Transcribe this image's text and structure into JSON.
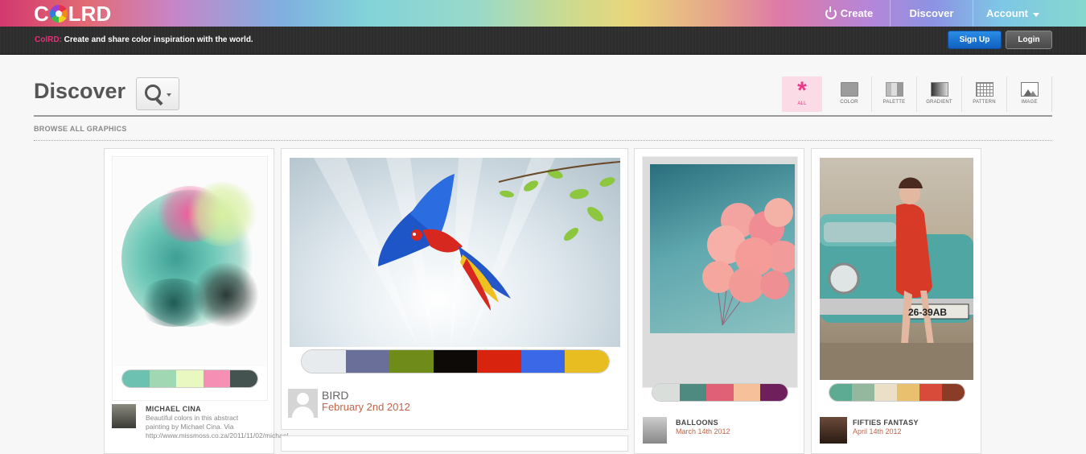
{
  "header": {
    "logo_left": "C",
    "logo_right": "LRD",
    "nav": {
      "create": "Create",
      "discover": "Discover",
      "account": "Account"
    }
  },
  "subbar": {
    "brand": "ColRD:",
    "tagline": " Create and share color inspiration with the world.",
    "signup": "Sign Up",
    "login": "Login"
  },
  "page": {
    "title": "Discover",
    "browse_label": "BROWSE ALL GRAPHICS"
  },
  "filters": [
    {
      "label": "ALL",
      "icon": "star-icon",
      "active": true
    },
    {
      "label": "COLOR",
      "icon": "color-icon"
    },
    {
      "label": "PALETTE",
      "icon": "palette-icon"
    },
    {
      "label": "GRADIENT",
      "icon": "gradient-icon"
    },
    {
      "label": "PATTERN",
      "icon": "pattern-icon"
    },
    {
      "label": "IMAGE",
      "icon": "image-icon"
    }
  ],
  "cards": [
    {
      "author": "MICHAEL CINA",
      "desc_line1": "Beautiful colors in this abstract",
      "desc_line2": "painting by Michael Cina. Via",
      "desc_line3": "http://www.missmoss.co.za/2011/11/02/michael",
      "swatches": [
        "#6cc1b0",
        "#9fd8b2",
        "#e9f7c0",
        "#f58fb3",
        "#445350"
      ]
    },
    {
      "title": "BIRD",
      "date": "February 2nd 2012",
      "swatches": [
        "#e8ebee",
        "#6a6f9a",
        "#6f8c1a",
        "#0d0a08",
        "#d8230f",
        "#3a68e6",
        "#e8bd22"
      ]
    },
    {
      "author": "BALLOONS",
      "date": "March 14th 2012",
      "swatches": [
        "#d9dedb",
        "#4e8a80",
        "#e06175",
        "#f5c09a",
        "#6e1f5c"
      ]
    },
    {
      "author": "FIFTIES FANTASY",
      "date": "April 14th 2012",
      "swatches": [
        "#5cab92",
        "#93b89e",
        "#ebdfc8",
        "#e8c06e",
        "#d84a3a",
        "#8a3c27"
      ]
    }
  ]
}
